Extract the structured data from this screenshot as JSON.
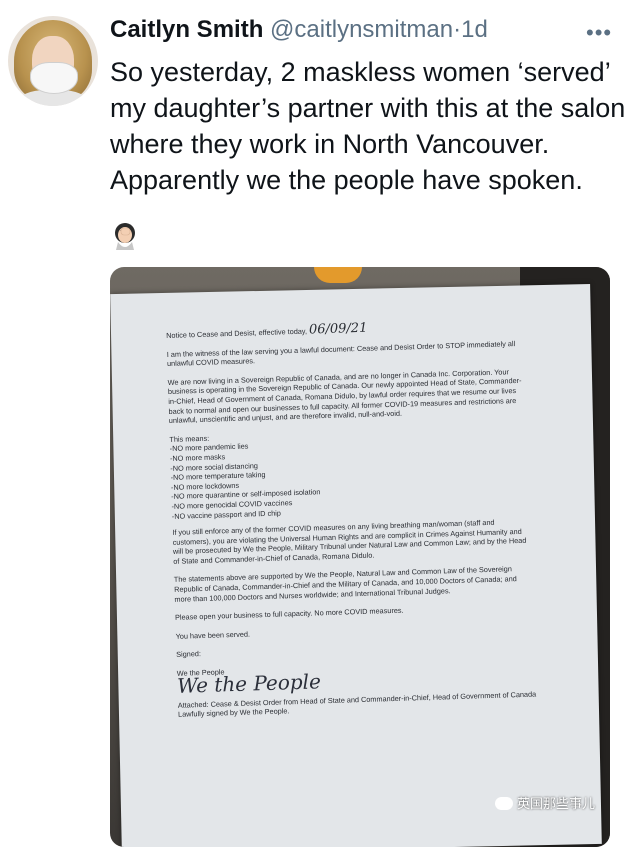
{
  "tweet": {
    "author_name": "Caitlyn Smith",
    "handle": "@caitlynsmitman",
    "separator": "·",
    "time": "1d",
    "more_icon": "more-horizontal-icon",
    "text": "So yesterday, 2 maskless women ‘served’ my daughter’s partner with this at the salon where they work in North Vancouver. Apparently we the people have spoken.",
    "emoji": "woman-facepalming-emoji"
  },
  "document": {
    "heading": "Notice to Cease and Desist, effective today,",
    "date": "06/09/21",
    "p1": "I am the witness of the law serving you a lawful document: Cease and Desist Order to STOP immediately all unlawful COVID measures.",
    "p2": "We are now living in a Sovereign Republic of Canada, and are no longer in Canada Inc. Corporation. Your business is operating in the Sovereign Republic of Canada. Our newly appointed Head of State, Commander-in-Chief, Head of Government of Canada, Romana Didulo, by lawful order requires that we resume our lives back to normal and open our businesses to full capacity. All former COVID-19 measures and restrictions are unlawful, unscientific and unjust, and are therefore invalid, null-and-void.",
    "means_label": "This means:",
    "means": [
      "-NO more pandemic lies",
      "-NO more masks",
      "-NO more social distancing",
      "-NO more temperature taking",
      "-NO more lockdowns",
      "-NO more quarantine or self-imposed isolation",
      "-NO more genocidal COVID vaccines",
      "-NO vaccine passport and ID chip"
    ],
    "p3": "If you still enforce any of the former COVID measures on any living breathing man/woman (staff and customers), you are violating the Universal Human Rights and are complicit in Crimes Against Humanity and will be prosecuted by We the People, Military Tribunal under Natural Law and Common Law; and by the Head of State and Commander-in-Chief of Canada, Romana Didulo.",
    "p4": "The statements above are supported by We the People, Natural Law and Common Law of the Sovereign Republic of Canada, Commander-in-Chief and the Military of Canada, and 10,000 Doctors of Canada; and more than 100,000 Doctors and Nurses worldwide; and International Tribunal Judges.",
    "p5": "Please open your business to full capacity. No more COVID measures.",
    "p6": "You have been served.",
    "signed": "Signed:",
    "we_the_people": "We the People",
    "signature": "We the People",
    "attached": "Attached: Cease & Desist Order from Head of State and Commander-in-Chief, Head of Government of Canada Lawfully signed by We the People."
  },
  "watermark": {
    "text": "英国那些事儿"
  }
}
